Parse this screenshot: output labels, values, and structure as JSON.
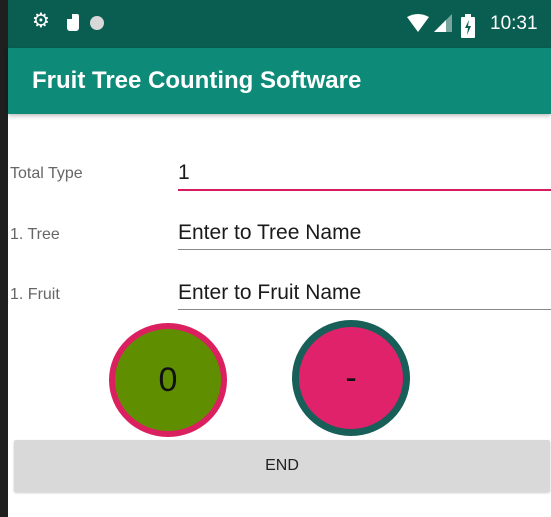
{
  "status_bar": {
    "time": "10:31",
    "icons": [
      "gear-icon",
      "sd-card-icon",
      "dot-icon",
      "wifi-icon",
      "signal-icon",
      "battery-charging-icon"
    ]
  },
  "app_bar": {
    "title": "Fruit Tree Counting Software",
    "color": "#0e8a79"
  },
  "form": {
    "total_type_label": "Total  Type",
    "total_type_value": "1",
    "tree_label": "1. Tree",
    "tree_placeholder": "Enter to Tree Name",
    "fruit_label": "1. Fruit",
    "fruit_placeholder": "Enter to Fruit Name"
  },
  "buttons": {
    "count_label": "0",
    "minus_label": "-",
    "end_label": "END"
  },
  "colors": {
    "status_bar": "#0a5e51",
    "accent": "#d81b60",
    "count_fill": "#5f8f00",
    "minus_fill": "#e0226a",
    "minus_ring": "#175f58"
  }
}
